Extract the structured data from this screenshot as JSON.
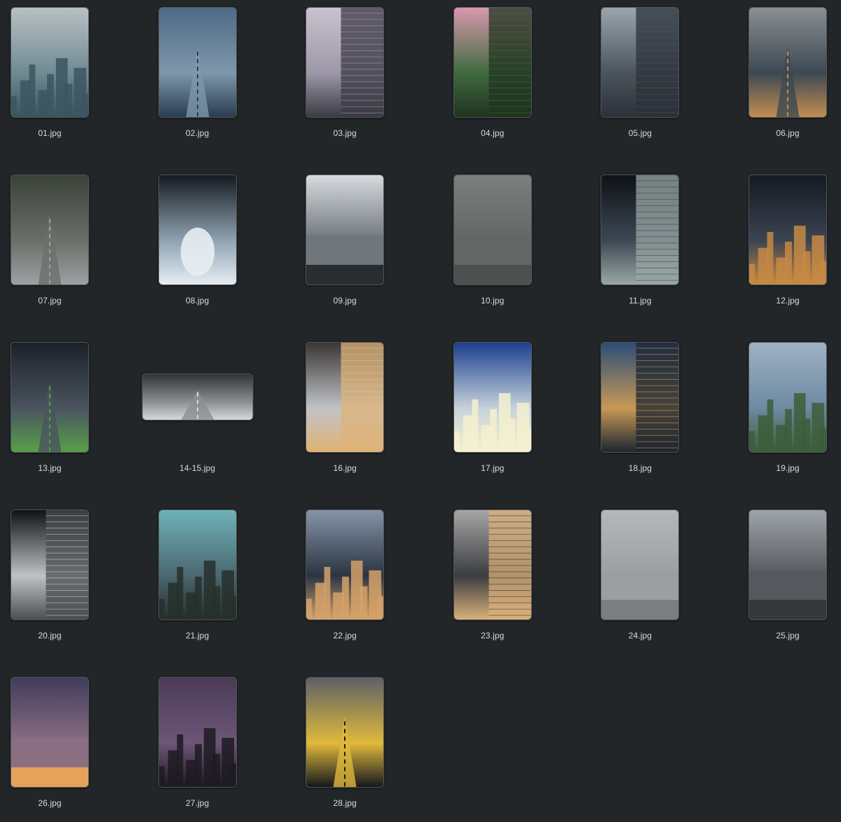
{
  "files": [
    {
      "name": "01.jpg",
      "scene": "city-skyline-haze",
      "colors": [
        "#b9c0c4",
        "#6f8a92",
        "#3c5560"
      ]
    },
    {
      "name": "02.jpg",
      "scene": "streetlamps-blue-sky",
      "colors": [
        "#4d6a86",
        "#7e97ab",
        "#2a3c4f"
      ]
    },
    {
      "name": "03.jpg",
      "scene": "building-corner-dusk",
      "colors": [
        "#c9c2ce",
        "#9c97a8",
        "#3c3a44"
      ]
    },
    {
      "name": "04.jpg",
      "scene": "park-pink-sky",
      "colors": [
        "#d898ad",
        "#3f6a3f",
        "#20331f"
      ]
    },
    {
      "name": "05.jpg",
      "scene": "parking-lot-aerial",
      "colors": [
        "#9aa5ae",
        "#4b545c",
        "#2b3138"
      ]
    },
    {
      "name": "06.jpg",
      "scene": "narrow-alley",
      "colors": [
        "#8a8f93",
        "#3c4852",
        "#c48e52"
      ]
    },
    {
      "name": "07.jpg",
      "scene": "tree-lined-street",
      "colors": [
        "#3a4238",
        "#6b6f6a",
        "#9ea0a2"
      ]
    },
    {
      "name": "08.jpg",
      "scene": "tunnel-silhouette",
      "colors": [
        "#151a20",
        "#8fa3b3",
        "#e7eef2"
      ]
    },
    {
      "name": "09.jpg",
      "scene": "beach-waves",
      "colors": [
        "#d6dade",
        "#6f767c",
        "#2a2d30"
      ]
    },
    {
      "name": "10.jpg",
      "scene": "grey-water-pier",
      "colors": [
        "#7b7e7d",
        "#626664",
        "#4d504f"
      ]
    },
    {
      "name": "11.jpg",
      "scene": "night-rooftop",
      "colors": [
        "#0e1216",
        "#3d4854",
        "#9aa7a4"
      ]
    },
    {
      "name": "12.jpg",
      "scene": "night-neighborhood",
      "colors": [
        "#151a22",
        "#3b4452",
        "#c78a44"
      ]
    },
    {
      "name": "13.jpg",
      "scene": "night-bus-street",
      "colors": [
        "#1b2128",
        "#4a545e",
        "#57a04a"
      ]
    },
    {
      "name": "14-15.jpg",
      "scene": "highway-tunnel-wide",
      "colors": [
        "#303436",
        "#8a8e90",
        "#d6d9da"
      ]
    },
    {
      "name": "16.jpg",
      "scene": "glass-facade-reflection",
      "colors": [
        "#3a3634",
        "#c1c4c7",
        "#e0b273"
      ]
    },
    {
      "name": "17.jpg",
      "scene": "office-tower-sun",
      "colors": [
        "#1c3f8e",
        "#c6d2db",
        "#f4f0d0"
      ]
    },
    {
      "name": "18.jpg",
      "scene": "golden-tower-grid",
      "colors": [
        "#2c4d77",
        "#c79955",
        "#1d2630"
      ]
    },
    {
      "name": "19.jpg",
      "scene": "river-city-view",
      "colors": [
        "#9eb2c3",
        "#6d8aa3",
        "#3d5d3a"
      ]
    },
    {
      "name": "20.jpg",
      "scene": "striped-building-dark",
      "colors": [
        "#0f1112",
        "#bfc3c6",
        "#4a4f53"
      ]
    },
    {
      "name": "21.jpg",
      "scene": "teal-city-tower",
      "colors": [
        "#6fb2b8",
        "#4b6770",
        "#26302c"
      ]
    },
    {
      "name": "22.jpg",
      "scene": "towers-sunset",
      "colors": [
        "#8494a7",
        "#2b3442",
        "#d5a26a"
      ]
    },
    {
      "name": "23.jpg",
      "scene": "skyscraper-reflection",
      "colors": [
        "#a7a6a6",
        "#3a3c3f",
        "#d9b07a"
      ]
    },
    {
      "name": "24.jpg",
      "scene": "foggy-river-boat",
      "colors": [
        "#b5b8ba",
        "#9c9fa1",
        "#7b7f82"
      ]
    },
    {
      "name": "25.jpg",
      "scene": "pier-cloudy-sea",
      "colors": [
        "#9ea4a9",
        "#55595e",
        "#34383b"
      ]
    },
    {
      "name": "26.jpg",
      "scene": "sunset-sea",
      "colors": [
        "#403c5a",
        "#8a6f83",
        "#e6a25a"
      ]
    },
    {
      "name": "27.jpg",
      "scene": "purple-dusk-tower",
      "colors": [
        "#4a3a56",
        "#6d5677",
        "#1d1a22"
      ]
    },
    {
      "name": "28.jpg",
      "scene": "car-road-aerial",
      "colors": [
        "#5c6166",
        "#e0b93b",
        "#14181c"
      ]
    }
  ]
}
